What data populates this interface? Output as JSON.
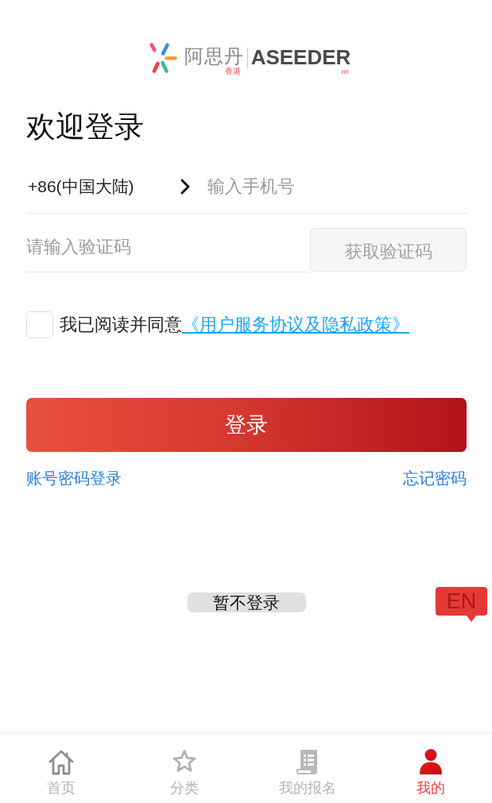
{
  "logo": {
    "name_cn": "阿思丹",
    "region_cn": "香港",
    "name_en": "ASEEDER",
    "region_en": "HK"
  },
  "title": "欢迎登录",
  "phone": {
    "country_code": "+86(中国大陆)",
    "placeholder": "输入手机号"
  },
  "verification": {
    "placeholder": "请输入验证码",
    "button": "获取验证码",
    "disabled": true
  },
  "agreement": {
    "checked": false,
    "text": "我已阅读并同意",
    "link": "《用户服务协议及隐私政策》"
  },
  "login_button": "登录",
  "links": {
    "password_login": "账号密码登录",
    "forgot_password": "忘记密码"
  },
  "skip_button": "暂不登录",
  "language_button": "EN",
  "tab_bar": [
    {
      "kind": "home",
      "label": "首页",
      "selected": false
    },
    {
      "kind": "star",
      "label": "分类",
      "selected": false
    },
    {
      "kind": "document",
      "label": "我的报名",
      "selected": false
    },
    {
      "kind": "person",
      "label": "我的",
      "selected": true
    }
  ]
}
